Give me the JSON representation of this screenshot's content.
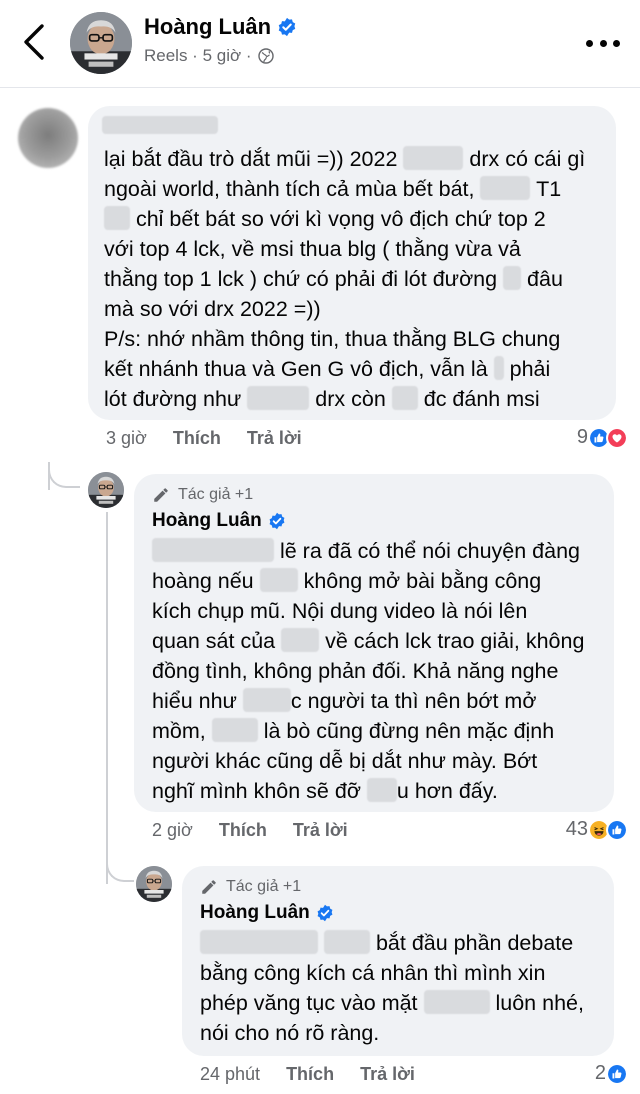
{
  "header": {
    "name": "Hoàng Luân",
    "meta": "Reels · 5 giờ ·",
    "verified_icon": "verified-badge-icon",
    "privacy_icon": "globe-icon"
  },
  "comments": [
    {
      "lines": [
        "lại bắt đầu trò dắt mũi =)) 2022 ",
        " drx có cái gì",
        "ngoài world, thành tích cả mùa bết bát, ",
        " T1",
        " chỉ bết bát so với kì vọng vô địch chứ top 2",
        "với top 4 lck, về msi thua blg ( thằng vừa vả",
        "thằng top 1 lck ) chứ có phải đi lót đường ",
        " đâu",
        "mà so với drx 2022 =))",
        "P/s: nhớ nhầm thông tin, thua thằng BLG chung",
        "kết nhánh thua và Gen G vô địch, vẫn là ",
        " phải",
        "lót đường như ",
        " drx còn ",
        " đc đánh msi"
      ],
      "time": "3 giờ",
      "like": "Thích",
      "reply": "Trả lời",
      "reaction_count": "9",
      "reactions": [
        "like-reaction-icon",
        "love-reaction-icon"
      ]
    },
    {
      "author_tag": "Tác giả +1",
      "name": "Hoàng Luân",
      "lines": [
        " lẽ ra đã có thể nói chuyện đàng",
        "hoàng nếu ",
        " không mở bài bằng công",
        "kích chụp mũ. Nội dung video là nói lên",
        "quan sát của ",
        " về cách lck trao giải, không",
        "đồng tình, không phản đối. Khả năng nghe",
        "hiểu như ",
        "c người ta thì nên bớt mở",
        "mồm, ",
        " là bò cũng đừng nên mặc định",
        "người khác cũng dễ bị dắt như mày. Bớt",
        "nghĩ mình khôn sẽ đỡ ",
        "u hơn đấy."
      ],
      "time": "2 giờ",
      "like": "Thích",
      "reply": "Trả lời",
      "reaction_count": "43",
      "reactions": [
        "haha-reaction-icon",
        "like-reaction-icon"
      ]
    },
    {
      "author_tag": "Tác giả +1",
      "name": "Hoàng Luân",
      "lines": [
        " bắt đầu phần debate",
        "bằng công kích cá nhân thì mình xin",
        "phép văng tục vào mặt ",
        " luôn nhé,",
        "nói cho nó rõ ràng."
      ],
      "time": "24 phút",
      "like": "Thích",
      "reply": "Trả lời",
      "reaction_count": "2",
      "reactions": [
        "like-reaction-icon"
      ]
    }
  ],
  "colors": {
    "bubble": "#f0f2f5",
    "secondary_text": "#65676b",
    "verified_blue": "#1877f2",
    "love_red": "#f33e58",
    "haha_yellow": "#f7b125"
  }
}
